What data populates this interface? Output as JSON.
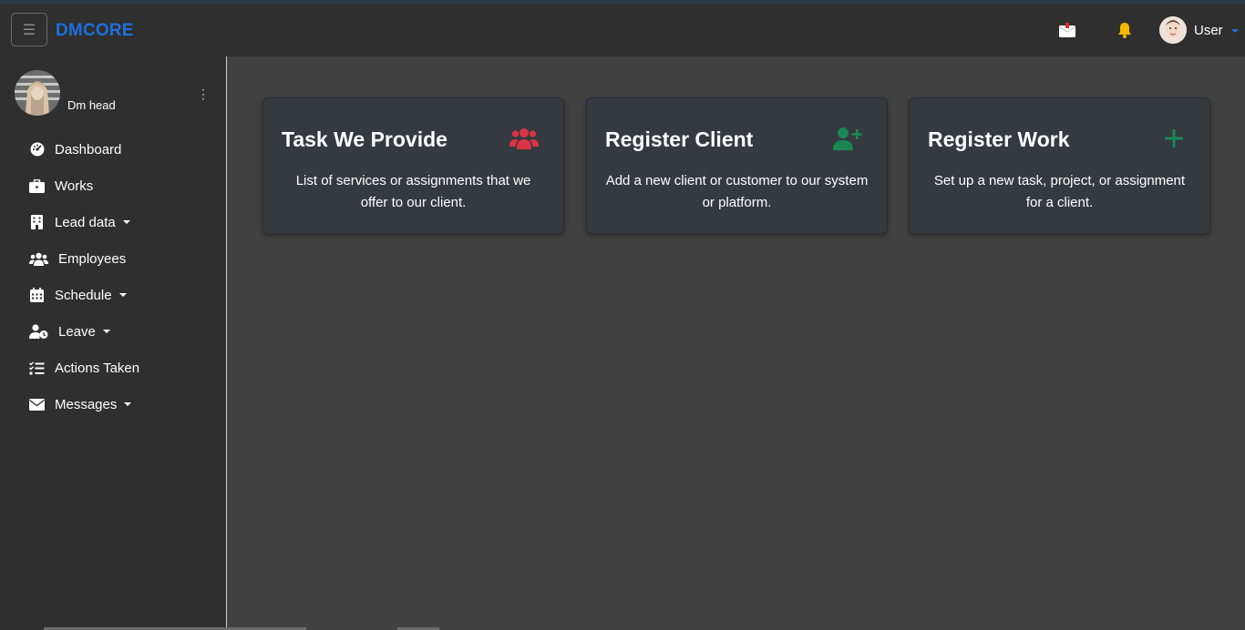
{
  "navbar": {
    "brand": "DMCORE",
    "user_label": "User",
    "icons": {
      "toggler": "menu-icon",
      "mail": "mail-icon",
      "bell": "bell-icon"
    }
  },
  "sidebar": {
    "profile_name": "Dm head",
    "items": [
      {
        "label": "Dashboard",
        "icon": "dashboard-icon",
        "has_caret": false
      },
      {
        "label": "Works",
        "icon": "briefcase-icon",
        "has_caret": false
      },
      {
        "label": "Lead data",
        "icon": "building-icon",
        "has_caret": true
      },
      {
        "label": "Employees",
        "icon": "users-icon",
        "has_caret": false
      },
      {
        "label": "Schedule",
        "icon": "calendar-icon",
        "has_caret": true
      },
      {
        "label": "Leave",
        "icon": "user-clock-icon",
        "has_caret": true
      },
      {
        "label": "Actions Taken",
        "icon": "list-check-icon",
        "has_caret": false
      },
      {
        "label": "Messages",
        "icon": "envelope-icon",
        "has_caret": true
      }
    ]
  },
  "cards": [
    {
      "title": "Task We Provide",
      "description": "List of services or assignments that we offer to our client.",
      "icon": "users-icon",
      "icon_color": "#dc3545"
    },
    {
      "title": "Register Client",
      "description": "Add a new client or customer to our system or platform.",
      "icon": "user-plus-icon",
      "icon_color": "#198754"
    },
    {
      "title": "Register Work",
      "description": "Set up a new task, project, or assignment for a client.",
      "icon": "plus-icon",
      "icon_color": "#198754"
    }
  ],
  "colors": {
    "brand": "#1e6fe0",
    "navbar_bg": "#2f2f2f",
    "content_bg": "#414141",
    "card_bg": "#343a40"
  }
}
